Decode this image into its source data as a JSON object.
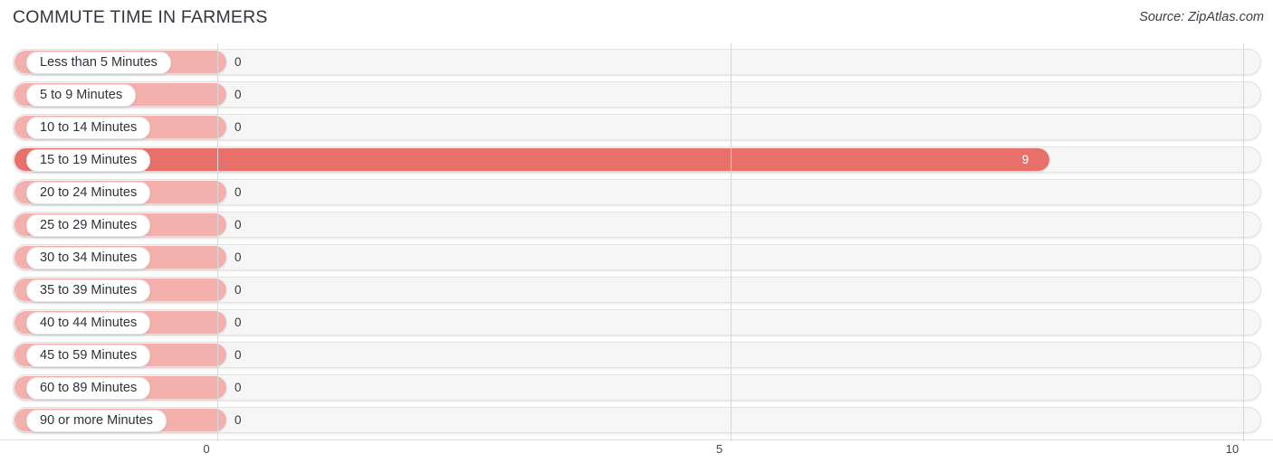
{
  "header": {
    "title": "COMMUTE TIME IN FARMERS",
    "source": "Source: ZipAtlas.com"
  },
  "chart_data": {
    "type": "bar",
    "orientation": "horizontal",
    "title": "COMMUTE TIME IN FARMERS",
    "xlabel": "",
    "ylabel": "",
    "xlim": [
      0,
      10
    ],
    "xticks": [
      0,
      5,
      10
    ],
    "xtick_labels": [
      "0",
      "5",
      "10"
    ],
    "grid": true,
    "legend": false,
    "categories": [
      "Less than 5 Minutes",
      "5 to 9 Minutes",
      "10 to 14 Minutes",
      "15 to 19 Minutes",
      "20 to 24 Minutes",
      "25 to 29 Minutes",
      "30 to 34 Minutes",
      "35 to 39 Minutes",
      "40 to 44 Minutes",
      "45 to 59 Minutes",
      "60 to 89 Minutes",
      "90 or more Minutes"
    ],
    "values": [
      0,
      0,
      0,
      9,
      0,
      0,
      0,
      0,
      0,
      0,
      0,
      0
    ],
    "value_labels": [
      "0",
      "0",
      "0",
      "9",
      "0",
      "0",
      "0",
      "0",
      "0",
      "0",
      "0",
      "0"
    ],
    "colors": {
      "bar_zero": "#f4b0ac",
      "bar_value": "#e8706b",
      "track": "#f6f6f6",
      "gridline": "#d8d8d8",
      "label_pill": "#ffffff"
    }
  },
  "rows": [
    {
      "label": "Less than 5 Minutes",
      "value": 0,
      "value_label": "0",
      "inside": false
    },
    {
      "label": "5 to 9 Minutes",
      "value": 0,
      "value_label": "0",
      "inside": false
    },
    {
      "label": "10 to 14 Minutes",
      "value": 0,
      "value_label": "0",
      "inside": false
    },
    {
      "label": "15 to 19 Minutes",
      "value": 9,
      "value_label": "9",
      "inside": true
    },
    {
      "label": "20 to 24 Minutes",
      "value": 0,
      "value_label": "0",
      "inside": false
    },
    {
      "label": "25 to 29 Minutes",
      "value": 0,
      "value_label": "0",
      "inside": false
    },
    {
      "label": "30 to 34 Minutes",
      "value": 0,
      "value_label": "0",
      "inside": false
    },
    {
      "label": "35 to 39 Minutes",
      "value": 0,
      "value_label": "0",
      "inside": false
    },
    {
      "label": "40 to 44 Minutes",
      "value": 0,
      "value_label": "0",
      "inside": false
    },
    {
      "label": "45 to 59 Minutes",
      "value": 0,
      "value_label": "0",
      "inside": false
    },
    {
      "label": "60 to 89 Minutes",
      "value": 0,
      "value_label": "0",
      "inside": false
    },
    {
      "label": "90 or more Minutes",
      "value": 0,
      "value_label": "0",
      "inside": false
    }
  ],
  "axis": {
    "ticks": [
      {
        "label": "0",
        "value": 0
      },
      {
        "label": "5",
        "value": 5
      },
      {
        "label": "10",
        "value": 10
      }
    ]
  }
}
